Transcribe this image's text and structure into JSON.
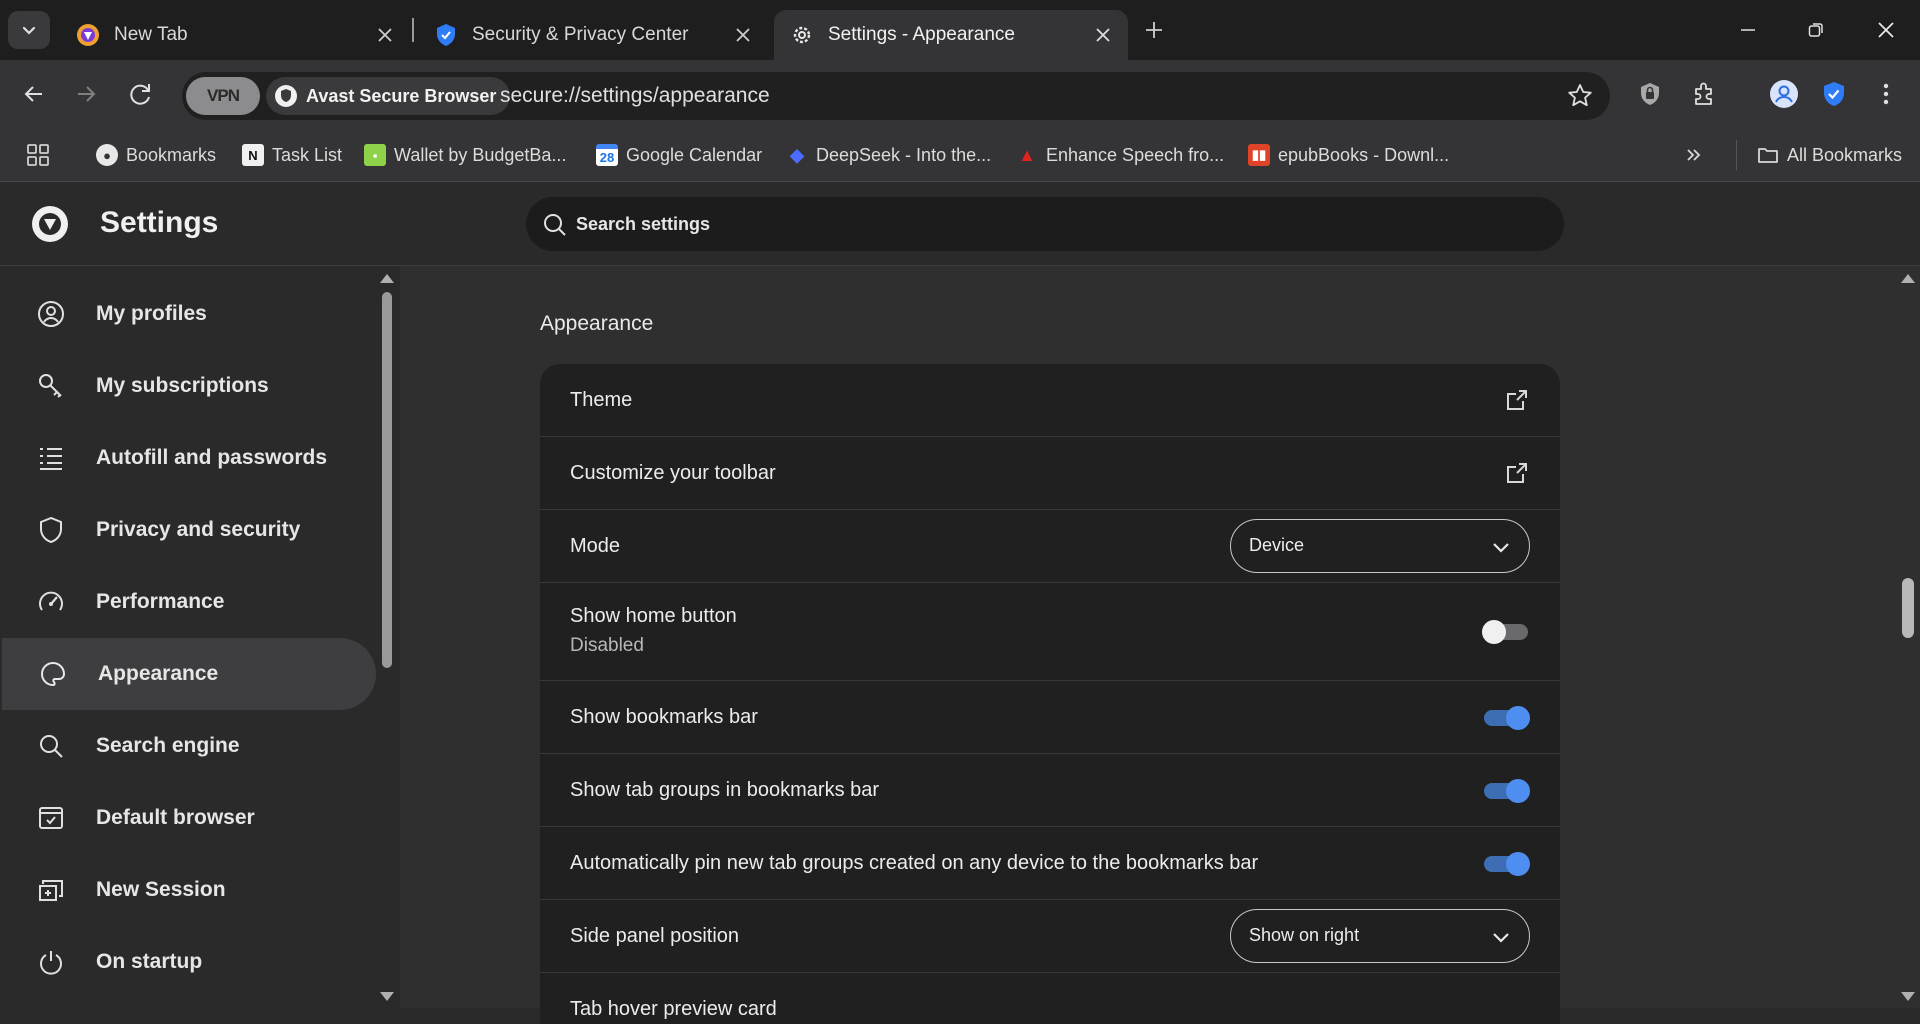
{
  "tabs": [
    {
      "title": "New Tab",
      "favicon": "avast-browser-icon"
    },
    {
      "title": "Security & Privacy Center",
      "favicon": "shield-check-icon"
    },
    {
      "title": "Settings - Appearance",
      "favicon": "gear-icon",
      "active": true
    }
  ],
  "toolbar": {
    "vpn_label": "VPN",
    "brand_label": "Avast Secure Browser",
    "url": "secure://settings/appearance"
  },
  "bookmarks": [
    {
      "label": "Bookmarks",
      "icon": "globe-icon"
    },
    {
      "label": "Task List",
      "icon": "notion-icon"
    },
    {
      "label": "Wallet by BudgetBa...",
      "icon": "wallet-icon"
    },
    {
      "label": "Google Calendar",
      "icon": "calendar-icon"
    },
    {
      "label": "DeepSeek - Into the...",
      "icon": "deepseek-icon"
    },
    {
      "label": "Enhance Speech fro...",
      "icon": "adobe-icon"
    },
    {
      "label": "epubBooks - Downl...",
      "icon": "epubbooks-icon"
    }
  ],
  "all_bookmarks": "All Bookmarks",
  "settings": {
    "title": "Settings",
    "search_placeholder": "Search settings"
  },
  "sidebar": {
    "items": [
      {
        "label": "My profiles",
        "icon": "profile-icon"
      },
      {
        "label": "My subscriptions",
        "icon": "key-icon"
      },
      {
        "label": "Autofill and passwords",
        "icon": "list-icon"
      },
      {
        "label": "Privacy and security",
        "icon": "shield-icon"
      },
      {
        "label": "Performance",
        "icon": "gauge-icon"
      },
      {
        "label": "Appearance",
        "icon": "palette-icon",
        "active": true
      },
      {
        "label": "Search engine",
        "icon": "search-icon"
      },
      {
        "label": "Default browser",
        "icon": "browser-icon"
      },
      {
        "label": "New Session",
        "icon": "new-session-icon"
      },
      {
        "label": "On startup",
        "icon": "power-icon"
      }
    ]
  },
  "main": {
    "section_title": "Appearance",
    "rows": {
      "theme": "Theme",
      "toolbar": "Customize your toolbar",
      "mode": "Mode",
      "mode_value": "Device",
      "home_button": "Show home button",
      "home_button_sub": "Disabled",
      "bookmarks_bar": "Show bookmarks bar",
      "tab_groups": "Show tab groups in bookmarks bar",
      "auto_pin": "Automatically pin new tab groups created on any device to the bookmarks bar",
      "side_panel": "Side panel position",
      "side_panel_value": "Show on right",
      "tab_hover": "Tab hover preview card"
    },
    "toggles": {
      "home_button": false,
      "bookmarks_bar": true,
      "tab_groups": true,
      "auto_pin": true
    }
  },
  "colors": {
    "accent": "#4d8ef0",
    "background": "#2a2a2b",
    "card": "#202021"
  }
}
